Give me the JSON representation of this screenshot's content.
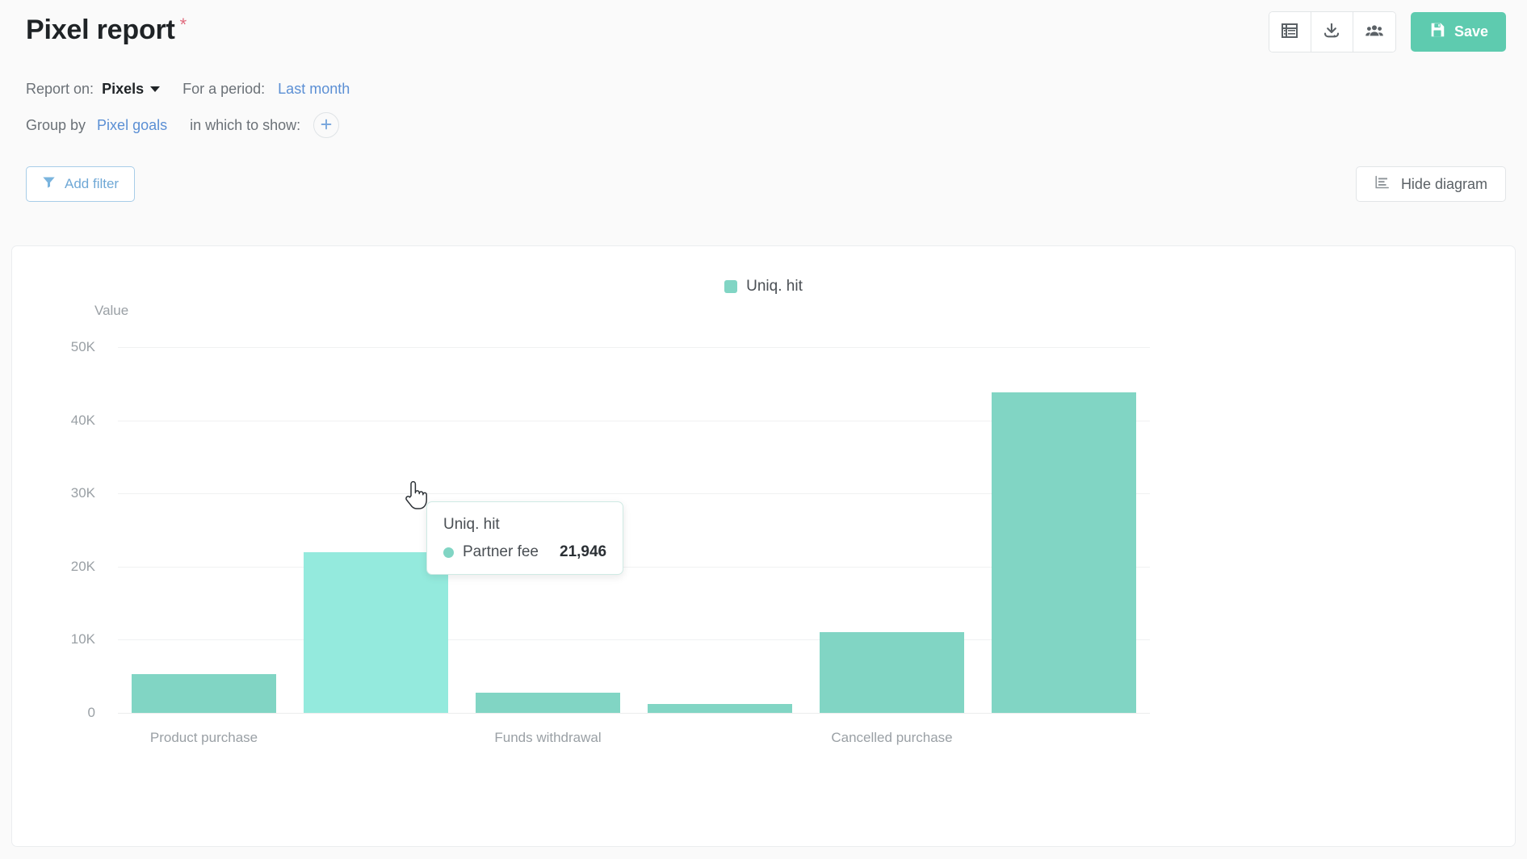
{
  "header": {
    "title": "Pixel report",
    "required_marker": "*",
    "report_on_label": "Report on:",
    "report_on_value": "Pixels",
    "period_label": "For a period:",
    "period_value": "Last month",
    "group_by_label": "Group by",
    "group_by_value": "Pixel goals",
    "in_which_label": "in which to show:",
    "add_dimension_icon": "plus-icon"
  },
  "toolbar": {
    "table_view_icon": "table-list-icon",
    "download_icon": "download-icon",
    "share_users_icon": "users-icon",
    "save_label": "Save",
    "save_icon": "floppy-disk-icon",
    "save_color": "#5ecbaf"
  },
  "actions": {
    "add_filter_label": "Add filter",
    "add_filter_icon": "funnel-icon",
    "hide_diagram_label": "Hide diagram",
    "hide_diagram_icon": "bar-chart-icon"
  },
  "tooltip": {
    "title": "Uniq. hit",
    "series_name": "Partner fee",
    "value": "21,946",
    "dot_color": "#81d5c4"
  },
  "chart_data": {
    "type": "bar",
    "title": "",
    "legend": [
      {
        "label": "Uniq. hit",
        "color": "#81d5c4"
      }
    ],
    "legend_position": "top-center",
    "ylabel": "Value",
    "xlabel": "",
    "ylim": [
      0,
      50000
    ],
    "yticks": [
      0,
      10000,
      20000,
      30000,
      40000,
      50000
    ],
    "ytick_labels": [
      "0",
      "10K",
      "20K",
      "30K",
      "40K",
      "50K"
    ],
    "grid": true,
    "categories": [
      "Product purchase",
      "",
      "Funds withdrawal",
      "",
      "Cancelled purchase",
      ""
    ],
    "xtick_labels": [
      "Product purchase",
      "Funds withdrawal",
      "Cancelled purchase"
    ],
    "series": [
      {
        "name": "Uniq. hit",
        "values": [
          5250,
          21946,
          2760,
          1215,
          11050,
          43800
        ]
      }
    ],
    "bar_color": "#81d5c4",
    "highlight_color": "#94eadd",
    "highlighted_index": 1
  }
}
